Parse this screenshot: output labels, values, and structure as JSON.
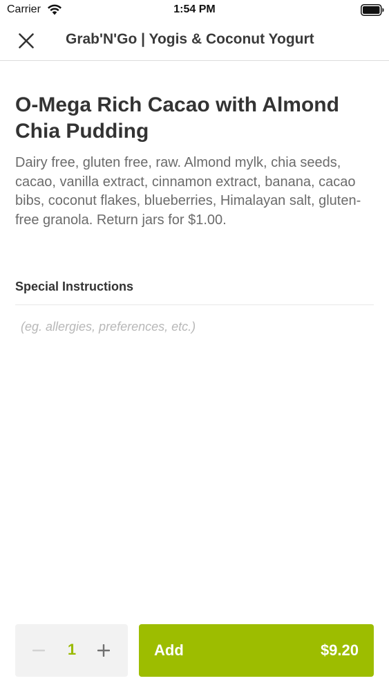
{
  "status_bar": {
    "carrier": "Carrier",
    "time": "1:54 PM"
  },
  "header": {
    "title": "Grab'N'Go | Yogis & Coconut Yogurt",
    "close_icon": "close-icon"
  },
  "item": {
    "title": "O-Mega Rich Cacao with Almond Chia Pudding",
    "description": "Dairy free, gluten free, raw. Almond mylk, chia seeds, cacao, vanilla extract, cinnamon extract, banana, cacao bibs, coconut flakes, blueberries, Himalayan salt, gluten-free granola. Return jars for $1.00."
  },
  "special_instructions": {
    "label": "Special Instructions",
    "placeholder": "(eg. allergies, preferences, etc.)",
    "value": ""
  },
  "quantity": {
    "value": "1",
    "minus_icon": "minus-icon",
    "plus_icon": "plus-icon"
  },
  "add_button": {
    "label": "Add",
    "price": "$9.20"
  },
  "colors": {
    "accent": "#9dbd00",
    "quantity_text": "#9aba00",
    "quantity_bg": "#f2f2f2",
    "description_text": "#6b6b6b"
  }
}
